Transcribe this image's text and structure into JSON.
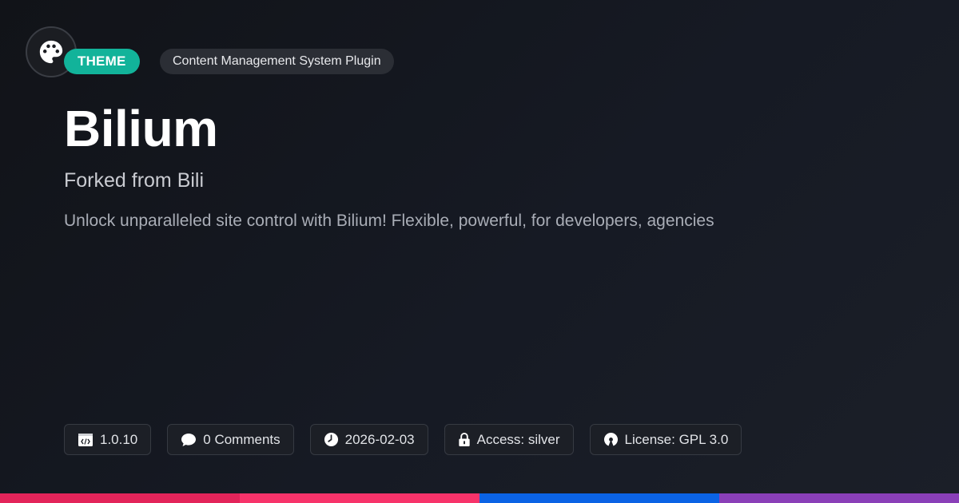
{
  "header": {
    "logo_icon": "palette-icon",
    "type_badge": "THEME",
    "category": "Content Management System Plugin"
  },
  "main": {
    "title": "Bilium",
    "subtitle": "Forked from Bili",
    "description": "Unlock unparalleled site control with Bilium! Flexible, powerful, for developers, agencies"
  },
  "meta": {
    "version": {
      "icon": "code-icon",
      "label": "1.0.10"
    },
    "comments": {
      "icon": "comment-icon",
      "label": "0 Comments"
    },
    "date": {
      "icon": "clock-icon",
      "label": "2026-02-03"
    },
    "access": {
      "icon": "lock-icon",
      "label": "Access: silver"
    },
    "license": {
      "icon": "open-source-icon",
      "label": "License: GPL 3.0"
    }
  },
  "colors": {
    "accent": "#12b39a",
    "bar": [
      "#e3245a",
      "#f7336a",
      "#0b63e5",
      "#8a3fb8"
    ]
  }
}
